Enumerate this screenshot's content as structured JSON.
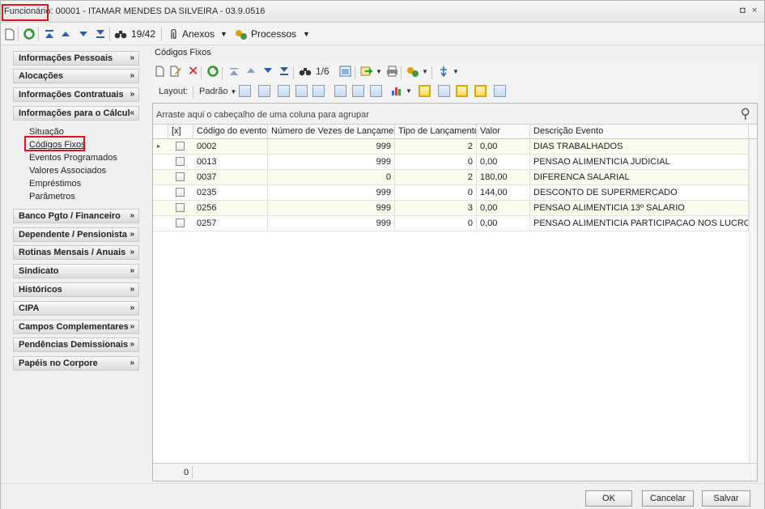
{
  "window": {
    "title_label": "Funcionário:",
    "title_value": " 00001 - ITAMAR MENDES DA SILVEIRA - 03.9.0516",
    "restore_glyph": "◘",
    "close_glyph": "×"
  },
  "toolbar": {
    "counter": "19/42",
    "anexos_label": "Anexos",
    "processos_label": "Processos"
  },
  "sidebar": {
    "groups": [
      {
        "label": "Informações Pessoais"
      },
      {
        "label": "Alocações"
      },
      {
        "label": "Informações Contratuais"
      },
      {
        "label": "Informações para o Cálcul"
      },
      {
        "label": "Banco Pgto / Financeiro"
      },
      {
        "label": "Dependente / Pensionista"
      },
      {
        "label": "Rotinas Mensais / Anuais"
      },
      {
        "label": "Sindicato"
      },
      {
        "label": "Históricos"
      },
      {
        "label": "CIPA"
      },
      {
        "label": "Campos Complementares"
      },
      {
        "label": "Pendências Demissionais"
      },
      {
        "label": "Papéis no Corpore"
      }
    ],
    "subitems": [
      {
        "label": "Situação"
      },
      {
        "label": "Códigos Fixos"
      },
      {
        "label": "Eventos Programados"
      },
      {
        "label": "Valores Associados"
      },
      {
        "label": "Empréstimos"
      },
      {
        "label": "Parâmetros"
      }
    ]
  },
  "panel": {
    "title": "Códigos Fixos",
    "counter": "1/6",
    "layout_label": "Layout:",
    "layout_value": "Padrão",
    "group_hint": "Arraste aqui o cabeçalho de uma coluna para agrupar",
    "footer_count": "0"
  },
  "table": {
    "columns": [
      {
        "label": "[x]"
      },
      {
        "label": "Código do evento"
      },
      {
        "label": "Número de Vezes de Lançamento"
      },
      {
        "label": "Tipo de Lançamento"
      },
      {
        "label": "Valor"
      },
      {
        "label": "Descrição Evento"
      }
    ],
    "rows": [
      {
        "codigo": "0002",
        "vezes": "999",
        "tipo": "2",
        "valor": "0,00",
        "descricao": "DIAS TRABALHADOS"
      },
      {
        "codigo": "0013",
        "vezes": "999",
        "tipo": "0",
        "valor": "0,00",
        "descricao": "PENSAO ALIMENTICIA JUDICIAL"
      },
      {
        "codigo": "0037",
        "vezes": "0",
        "tipo": "2",
        "valor": "180,00",
        "descricao": "DIFERENCA SALARIAL"
      },
      {
        "codigo": "0235",
        "vezes": "999",
        "tipo": "0",
        "valor": "144,00",
        "descricao": "DESCONTO DE SUPERMERCADO"
      },
      {
        "codigo": "0256",
        "vezes": "999",
        "tipo": "3",
        "valor": "0,00",
        "descricao": "PENSAO ALIMENTICIA 13º SALARIO"
      },
      {
        "codigo": "0257",
        "vezes": "999",
        "tipo": "0",
        "valor": "0,00",
        "descricao": "PENSAO ALIMENTICIA PARTICIPACAO NOS LUCROS"
      }
    ]
  },
  "buttons": {
    "ok": "OK",
    "cancel": "Cancelar",
    "save": "Salvar"
  }
}
